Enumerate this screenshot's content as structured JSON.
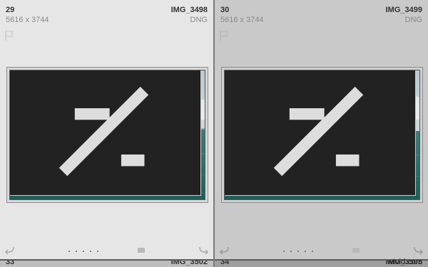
{
  "cells": [
    {
      "index": "29",
      "filename": "IMG_3498",
      "dimensions": "5616 x 3744",
      "extension": "DNG",
      "selected": false
    },
    {
      "index": "30",
      "filename": "IMG_3499",
      "dimensions": "5616 x 3744",
      "extension": "DNG",
      "selected": true
    }
  ],
  "next_row": [
    {
      "index": "33",
      "filename": "IMG_3502"
    },
    {
      "index": "34",
      "filename": "IMG_3503"
    }
  ],
  "icons": {
    "flag": "flag-icon",
    "badge": "edit-badge-icon",
    "develop": "develop-adjustment-icon",
    "rotate_left": "rotate-left-icon",
    "rotate_right": "rotate-right-icon"
  },
  "rating_dots": 5,
  "watermark": "wtvid.com",
  "colors": {
    "cell_bg": "#e6e6e6",
    "cell_selected_bg": "#c9c9c9"
  }
}
